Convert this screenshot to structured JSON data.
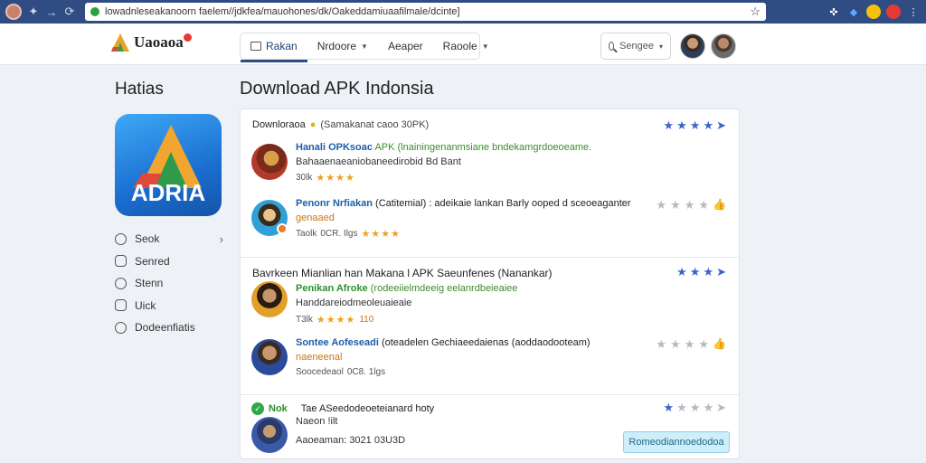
{
  "browser": {
    "url": "lowadnleseakanoorn faelem//jdkfea/mauohones/dk/Oakeddamiuaafilmale/dcinte]",
    "extension_colors": [
      "#ffffff",
      "#5fa8ff",
      "#f4c20d",
      "#e53935",
      "#ffffff"
    ]
  },
  "site": {
    "logo_text": "Uaoaoa",
    "nav": [
      {
        "label": "Rakan"
      },
      {
        "label": "Nrdoore"
      },
      {
        "label": "Aeaper"
      },
      {
        "label": "Raoole"
      }
    ],
    "search_placeholder": "Sengee"
  },
  "sidebar": {
    "title": "Hatias",
    "items": [
      {
        "label": "Seok",
        "icon": "chat-icon"
      },
      {
        "label": "Senred",
        "icon": "message-icon"
      },
      {
        "label": "Stenn",
        "icon": "phone-icon"
      },
      {
        "label": "Uick",
        "icon": "file-icon"
      },
      {
        "label": "Dodeenfiatis",
        "icon": "bubble-icon"
      }
    ]
  },
  "main": {
    "title": "Download APK Indonsia",
    "sections": [
      {
        "head": "Downloraoa",
        "head_sub": "(Samakanat caoo 30PK)",
        "items": [
          {
            "name": "Hanali OPKsoac",
            "name_rest": "APK (lnainingenanmsiane bndekamgrdoeoeame.",
            "line2": "Bahaaenaeaniobaneedirobid Bd Bant",
            "line3": "30lk"
          },
          {
            "name": "Penonr Nrfiakan",
            "name_rest": "(Catitemial) : adeikaie lankan Barly ooped d sceoeaganter",
            "line2": "genaaed",
            "line3": "Taolk",
            "line3_extra": "0CR. Ilgs"
          }
        ]
      },
      {
        "head": "Bavrkeen Mianlian han Makana l APK Saeunfenes (Nanankar)",
        "items": [
          {
            "name": "Penikan Afroke",
            "name_rest": "(rodeeiielmdeeig eelanrdbeieaiee",
            "line2": "Handdareiodmeoleuaieaie",
            "line3": "T3lk",
            "line3_extra": "110"
          },
          {
            "name": "Sontee Aofeseadi",
            "name_rest": "(oteadelen Gechiaeedaienas (aoddaodooteam)",
            "line2": "naeneenal",
            "line3": "Soocedeaol",
            "line3_extra": "0C8. 1lgs"
          }
        ]
      },
      {
        "head_badge": "Nok",
        "head": "Tae ASeedodeoeteianard hoty",
        "item": {
          "line1": "Naeon !ilt",
          "line2": "Aaoeaman: 3021 03U3D"
        },
        "cta": "Romeodiannoedodoa"
      }
    ]
  }
}
